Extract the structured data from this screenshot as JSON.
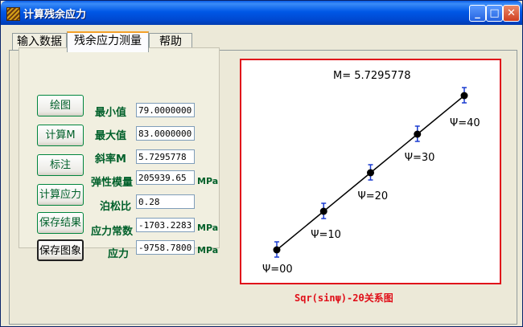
{
  "window": {
    "title": "计算残余应力"
  },
  "titlebar_buttons": {
    "minimize": "_",
    "maximize": "□",
    "close": "✕"
  },
  "tabs": [
    {
      "label": "输入数据",
      "active": false
    },
    {
      "label": "残余应力测量",
      "active": true
    },
    {
      "label": "帮助",
      "active": false
    }
  ],
  "buttons": {
    "plot": "绘图",
    "calc_m": "计算M",
    "annotate": "标注",
    "calc_stress": "计算应力",
    "save_result": "保存结果",
    "save_image": "保存图象"
  },
  "fields": {
    "min_label": "最小值",
    "min_value": "79.0000000",
    "max_label": "最大值",
    "max_value": "83.0000000",
    "slope_label": "斜率M",
    "slope_value": "5.7295778",
    "modulus_label": "弹性模量",
    "modulus_value": "205939.65",
    "modulus_unit": "MPa",
    "poisson_label": "泊松比",
    "poisson_value": "0.28",
    "stress_const_label": "应力常数",
    "stress_const_value": "-1703.2283",
    "stress_const_unit": "MPa",
    "stress_label": "应力",
    "stress_value": "-9758.7800",
    "stress_unit": "MPa"
  },
  "plot": {
    "equation": "M= 5.7295778",
    "caption": "Sqr(sinψ)-2θ关系图",
    "line_color": "#000000",
    "frame_color": "#e0101a",
    "errorbar_color": "#1a3cd0",
    "points": [
      {
        "label": "Ψ=00"
      },
      {
        "label": "Ψ=10"
      },
      {
        "label": "Ψ=20"
      },
      {
        "label": "Ψ=30"
      },
      {
        "label": "Ψ=40"
      }
    ]
  }
}
